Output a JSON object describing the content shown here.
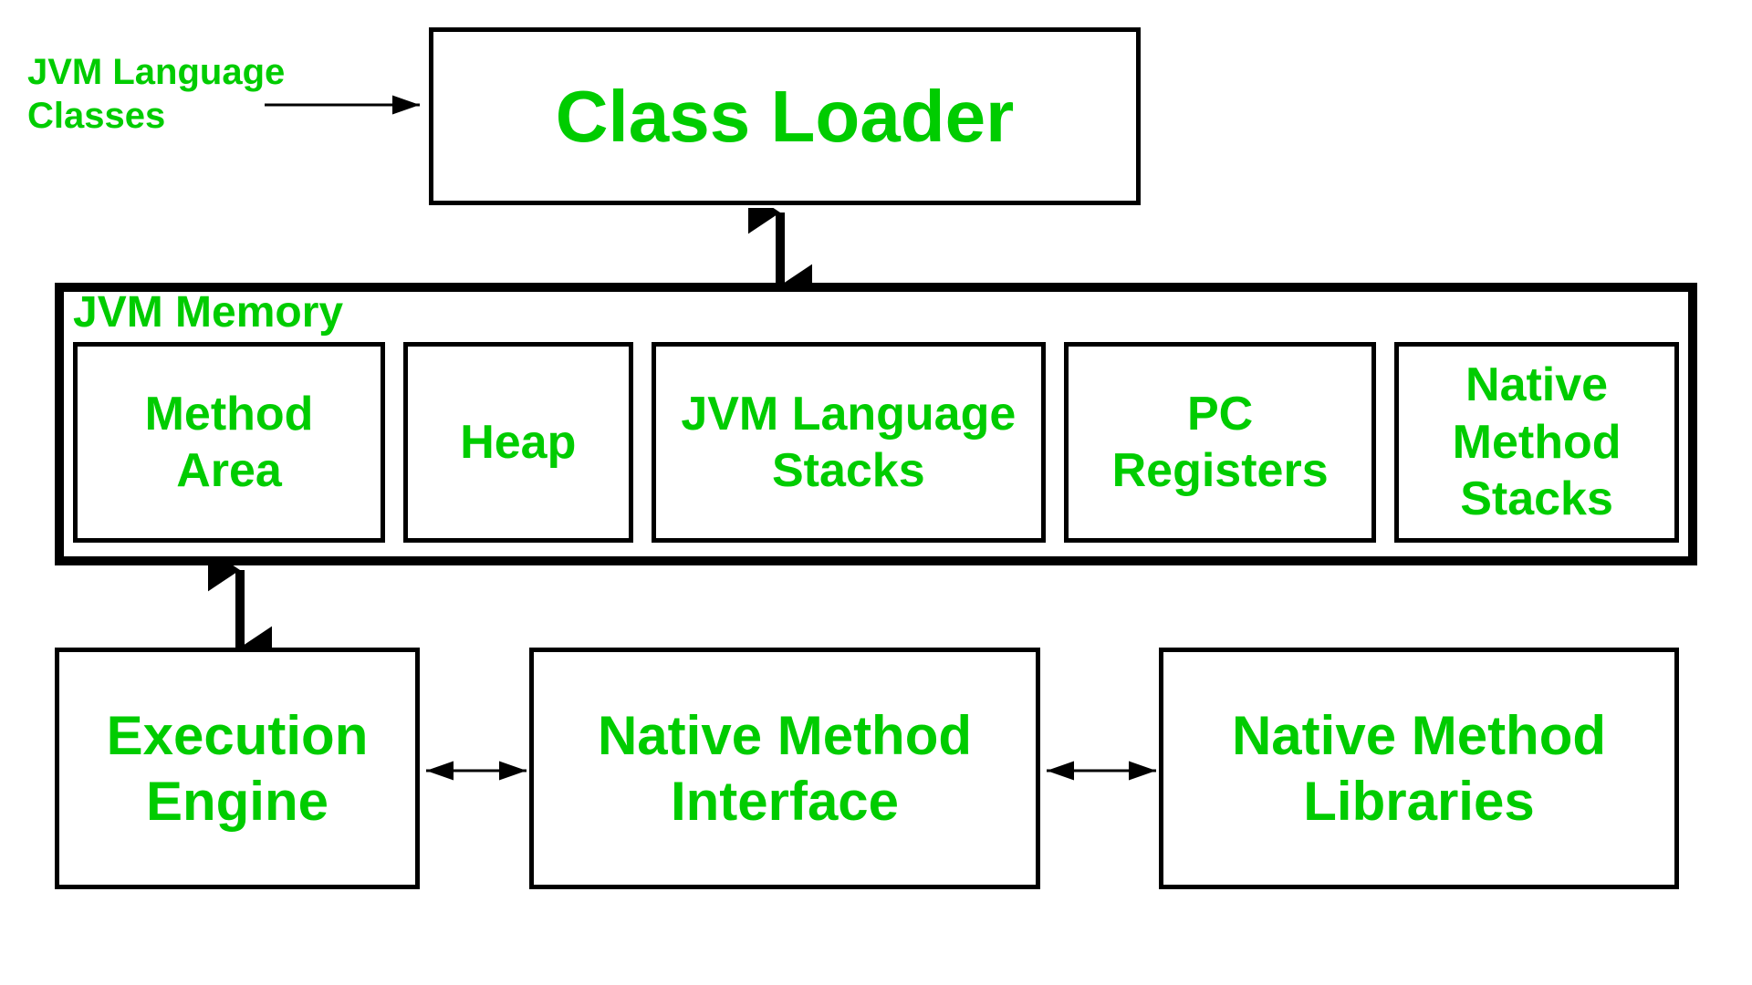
{
  "diagram": {
    "background": "#ffffff",
    "jvmLanguageClasses": {
      "line1": "JVM Language",
      "line2": "Classes"
    },
    "classLoader": {
      "label": "Class Loader"
    },
    "jvmMemory": {
      "label": "JVM Memory",
      "boxes": [
        {
          "id": "method-area",
          "label": "Method\nArea"
        },
        {
          "id": "heap",
          "label": "Heap"
        },
        {
          "id": "jvm-stacks",
          "label": "JVM Language\nStacks"
        },
        {
          "id": "pc-registers",
          "label": "PC\nRegisters"
        },
        {
          "id": "native-stacks",
          "label": "Native\nMethod\nStacks"
        }
      ]
    },
    "bottomBoxes": [
      {
        "id": "execution-engine",
        "label": "Execution\nEngine"
      },
      {
        "id": "native-method-interface",
        "label": "Native Method\nInterface"
      },
      {
        "id": "native-method-libraries",
        "label": "Native Method\nLibraries"
      }
    ],
    "colors": {
      "green": "#00cc00",
      "black": "#000000",
      "white": "#ffffff"
    }
  }
}
